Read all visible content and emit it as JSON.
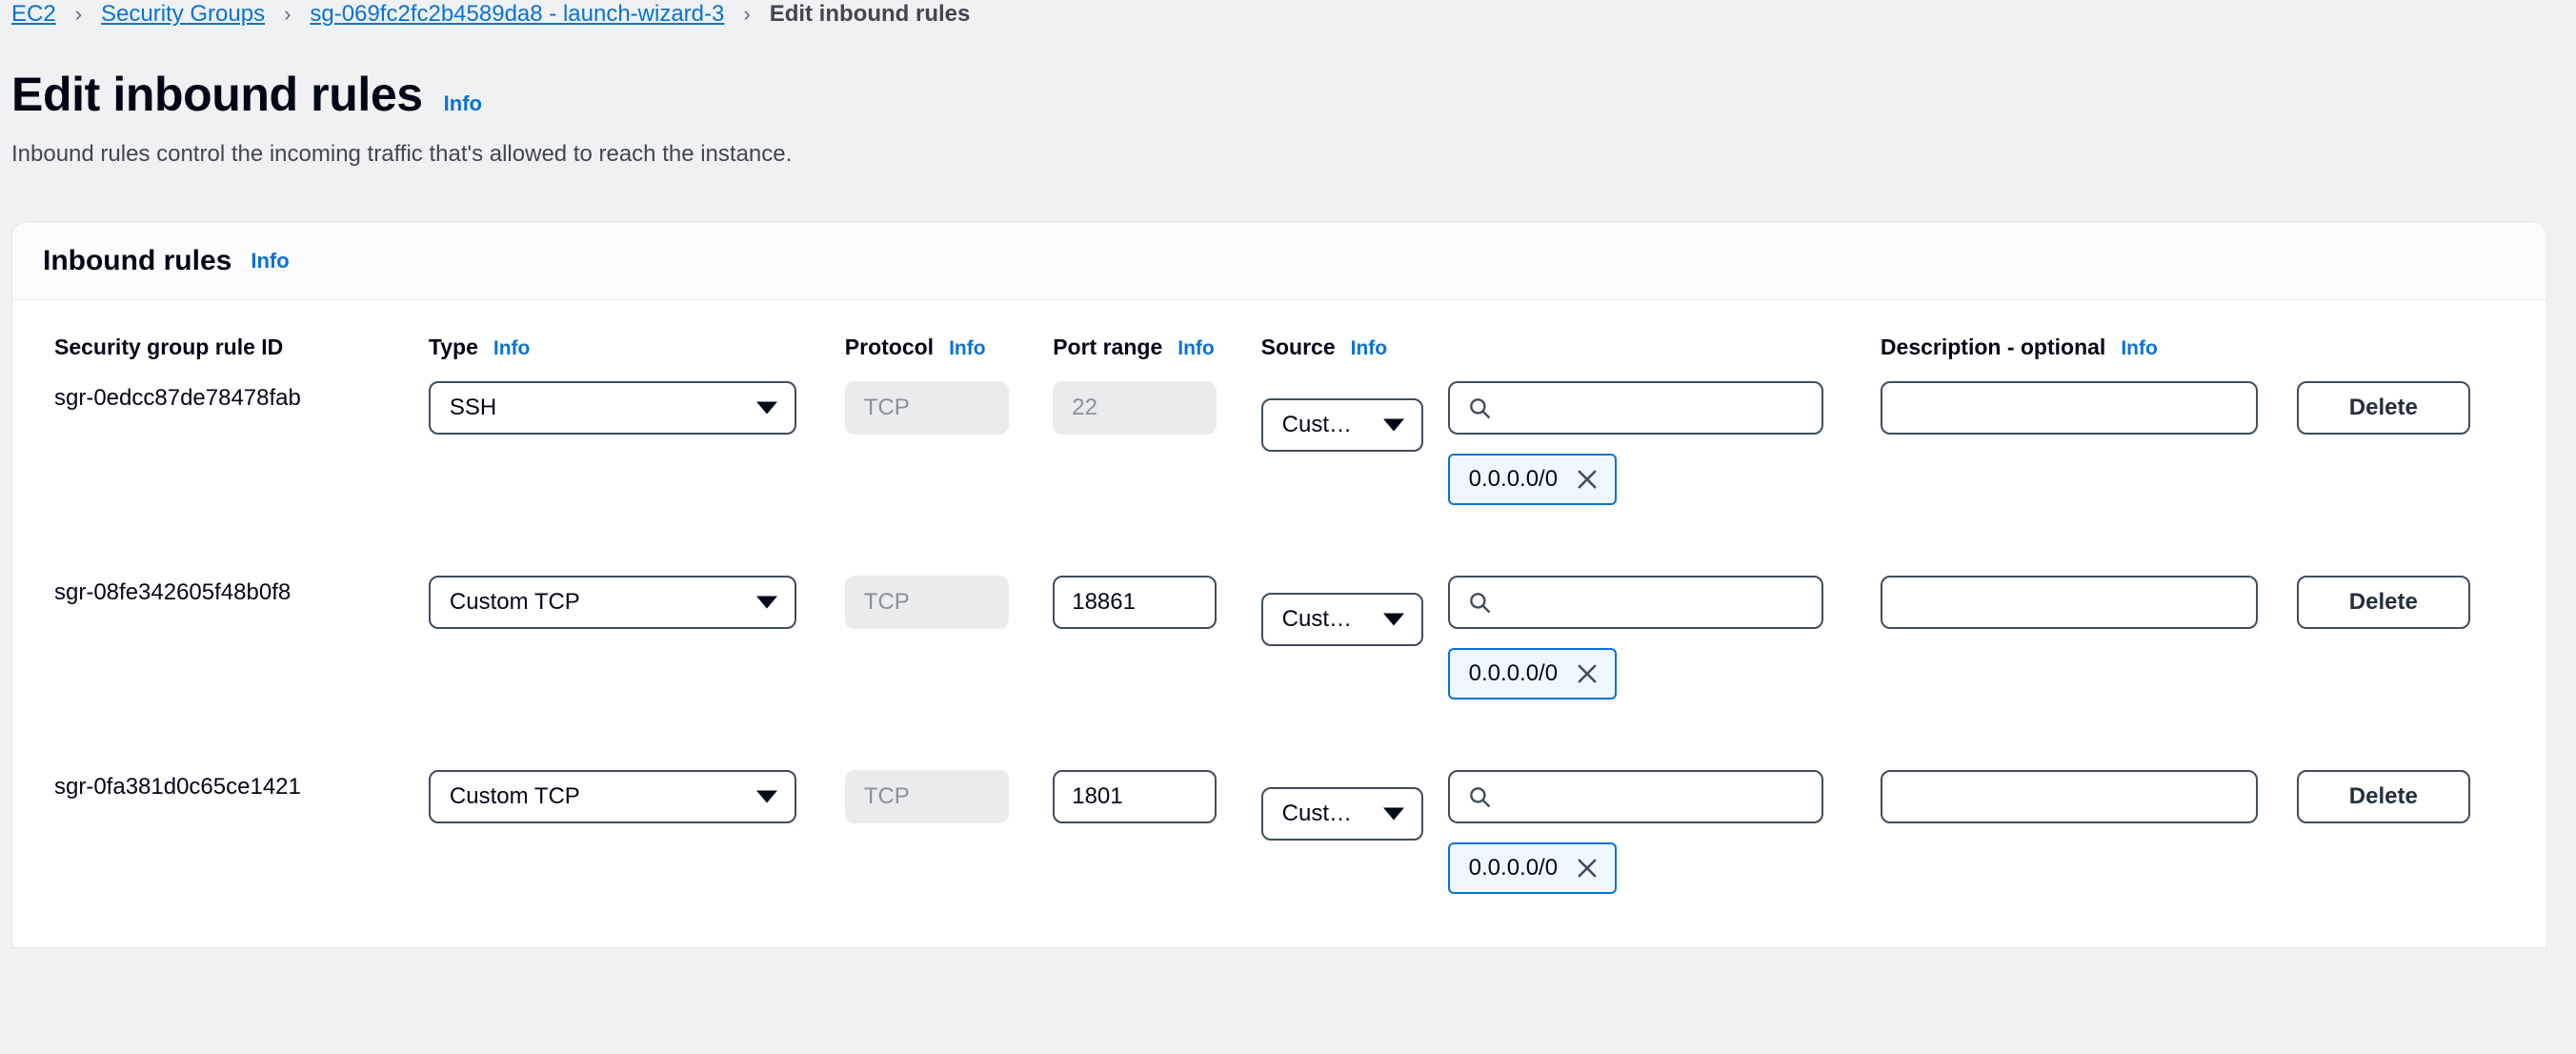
{
  "breadcrumb": {
    "items": [
      {
        "label": "EC2",
        "current": false
      },
      {
        "label": "Security Groups",
        "current": false
      },
      {
        "label": "sg-069fc2fc2b4589da8 - launch-wizard-3",
        "current": false
      },
      {
        "label": "Edit inbound rules",
        "current": true
      }
    ],
    "separator": "›"
  },
  "header": {
    "title": "Edit inbound rules",
    "info_label": "Info",
    "description": "Inbound rules control the incoming traffic that's allowed to reach the instance."
  },
  "card": {
    "title": "Inbound rules",
    "info_label": "Info"
  },
  "table": {
    "columns": {
      "rule_id": {
        "label": "Security group rule ID",
        "info": ""
      },
      "type": {
        "label": "Type",
        "info": "Info"
      },
      "protocol": {
        "label": "Protocol",
        "info": "Info"
      },
      "port_range": {
        "label": "Port range",
        "info": "Info"
      },
      "source": {
        "label": "Source",
        "info": "Info"
      },
      "description": {
        "label": "Description - optional",
        "info": "Info"
      },
      "actions": {
        "label": ""
      }
    },
    "rows": [
      {
        "rule_id": "sgr-0edcc87de78478fab",
        "type": "SSH",
        "protocol": "TCP",
        "protocol_disabled": true,
        "port_range": "22",
        "port_disabled": true,
        "source_type": "Cust…",
        "source_search_value": "",
        "source_tokens": [
          "0.0.0.0/0"
        ],
        "description": "",
        "delete_label": "Delete"
      },
      {
        "rule_id": "sgr-08fe342605f48b0f8",
        "type": "Custom TCP",
        "protocol": "TCP",
        "protocol_disabled": true,
        "port_range": "18861",
        "port_disabled": false,
        "source_type": "Cust…",
        "source_search_value": "",
        "source_tokens": [
          "0.0.0.0/0"
        ],
        "description": "",
        "delete_label": "Delete"
      },
      {
        "rule_id": "sgr-0fa381d0c65ce1421",
        "type": "Custom TCP",
        "protocol": "TCP",
        "protocol_disabled": true,
        "port_range": "1801",
        "port_disabled": false,
        "source_type": "Cust…",
        "source_search_value": "",
        "source_tokens": [
          "0.0.0.0/0"
        ],
        "description": "",
        "delete_label": "Delete"
      }
    ]
  },
  "colors": {
    "link": "#0972d3",
    "text": "#000716",
    "muted": "#424650",
    "border": "#414d5c",
    "disabled_bg": "#e9ebed",
    "token_bg": "#f0f8ff",
    "page_bg": "#f0f1f2"
  }
}
